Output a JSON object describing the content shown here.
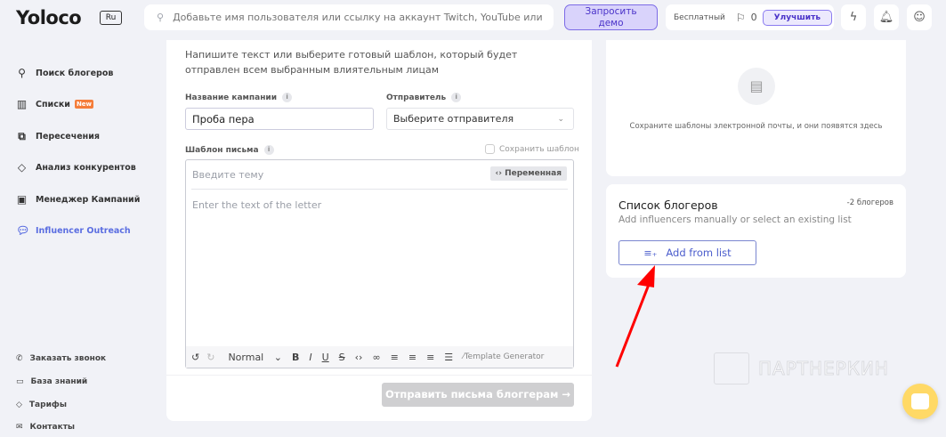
{
  "header": {
    "logo": "Yoloco",
    "lang": "Ru",
    "search_placeholder": "Добавьте имя пользователя или ссылку на аккаунт Twitch, YouTube или Instag...",
    "demo_line1": "Запросить",
    "demo_line2": "демо",
    "plan": "Бесплатный",
    "flag_count": "0",
    "upgrade": "Улучшить"
  },
  "sidebar": {
    "items": [
      {
        "label": "Поиск блогеров",
        "icon": "search-icon"
      },
      {
        "label": "Списки",
        "badge": "New",
        "icon": "chart-icon"
      },
      {
        "label": "Пересечения",
        "icon": "copy-icon"
      },
      {
        "label": "Анализ конкурентов",
        "icon": "tag-icon"
      },
      {
        "label": "Менеджер Кампаний",
        "icon": "user-card-icon"
      },
      {
        "label": "Influencer Outreach",
        "icon": "chat-icon",
        "active": true
      }
    ],
    "bottom": [
      {
        "label": "Заказать звонок",
        "icon": "phone-icon"
      },
      {
        "label": "База знаний",
        "icon": "message-icon"
      },
      {
        "label": "Тарифы",
        "icon": "tag-icon"
      },
      {
        "label": "Контакты",
        "icon": "mail-icon"
      }
    ]
  },
  "main": {
    "intro": "Напишите текст или выберите готовый шаблон, который будет отправлен всем выбранным влиятельным лицам",
    "campaign_label": "Название кампании",
    "campaign_value": "Проба пера",
    "sender_label": "Отправитель",
    "sender_placeholder": "Выберите отправителя",
    "template_label": "Шаблон письма",
    "save_template": "Сохранить шаблон",
    "subject_placeholder": "Введите тему",
    "variable_btn": "Переменная",
    "body_placeholder": "Enter the text of the letter",
    "format": "Normal",
    "template_generator": "Template Generator",
    "send": "Отправить письма блоггерам →"
  },
  "templates": {
    "empty": "Сохраните шаблоны электронной почты, и они появятся здесь"
  },
  "bloggers": {
    "title": "Список блогеров",
    "count": "-2 блогеров",
    "hint": "Add influencers manually or select an existing list",
    "add": "Add from list"
  },
  "watermark": "ПАРТНЕРКИН",
  "colors": {
    "accent": "#4a33c9",
    "active_nav": "#5b6ee1",
    "arrow": "#ff0000",
    "chat": "#ffd966"
  }
}
